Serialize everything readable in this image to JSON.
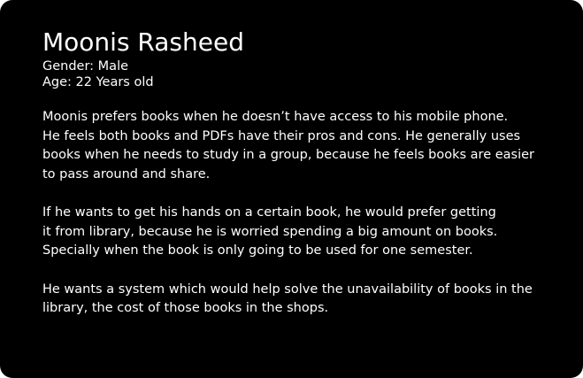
{
  "persona": {
    "name": "Moonis Rasheed",
    "gender": "Gender: Male",
    "age": "Age: 22 Years old"
  },
  "bio": [
    "Moonis prefers books when he doesn’t have access to his mobile phone.\nHe feels both books and PDFs have their pros and cons. He generally uses\nbooks when he needs to study in a group, because he feels books are easier\nto pass around and share.",
    "If he wants to get his hands on a certain book, he would prefer getting\nit from library, because he is worried spending a big amount on books.\nSpecially when the book is only going to be used for one semester.",
    "He wants a system which would help solve the unavailability of books in the\nlibrary, the cost of those books in the shops."
  ],
  "colors": {
    "background": "#000000",
    "text": "#ffffff"
  }
}
